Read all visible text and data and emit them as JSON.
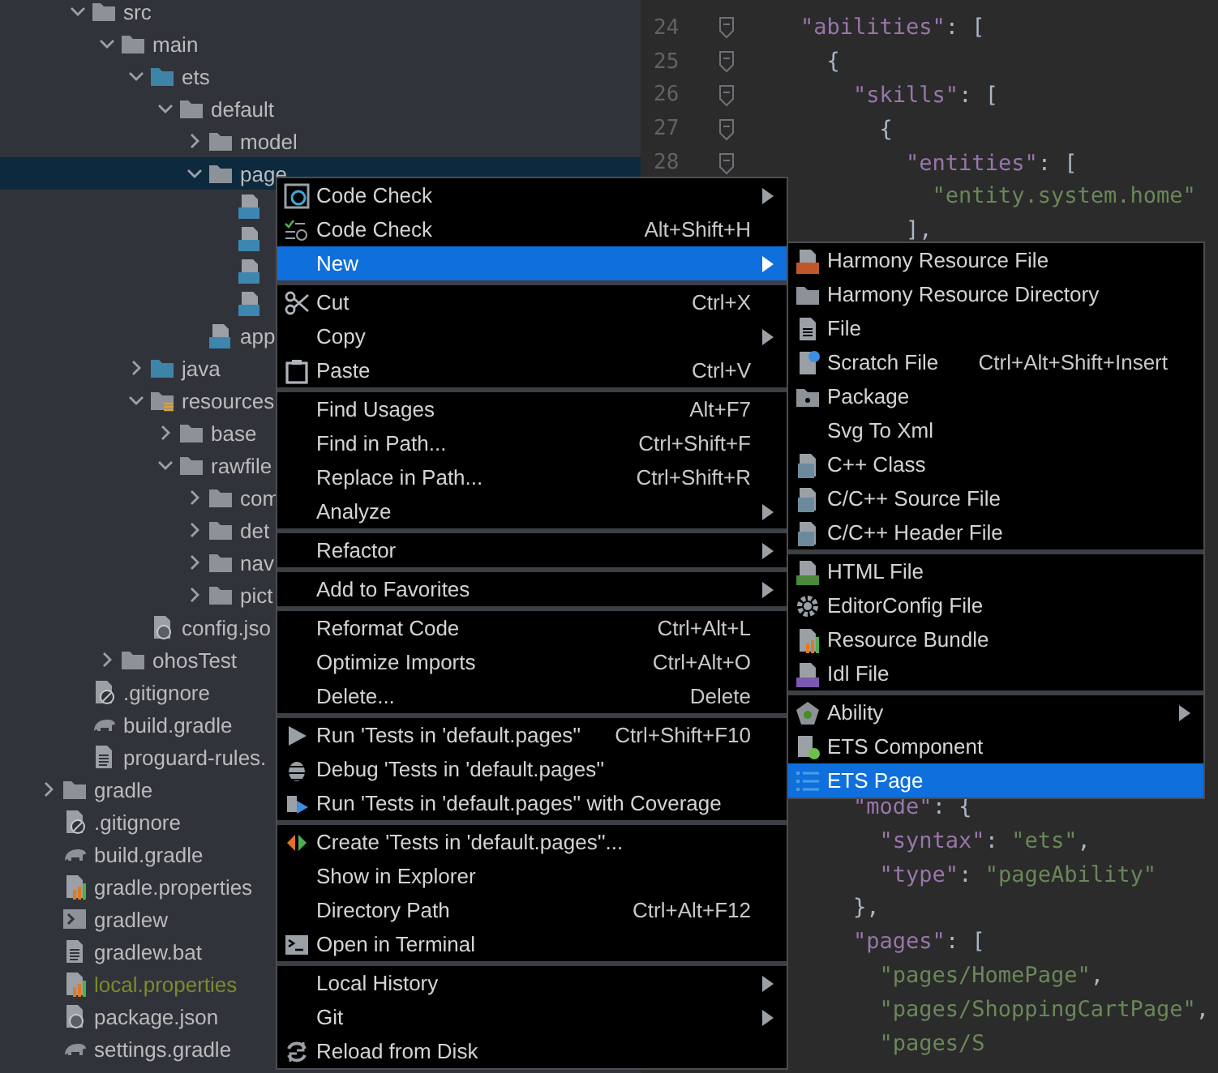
{
  "project_tree": {
    "partial_children": [
      {
        "label": "src",
        "kind": "folder",
        "expanded": true,
        "selected": false,
        "children": [
          {
            "label": "main",
            "kind": "folder",
            "expanded": true,
            "selected": false,
            "children": [
              {
                "label": "ets",
                "kind": "source-folder",
                "expanded": true,
                "selected": false,
                "children": [
                  {
                    "label": "default",
                    "kind": "folder",
                    "expanded": true,
                    "selected": false,
                    "children": [
                      {
                        "label": "model",
                        "kind": "folder",
                        "expanded": false,
                        "selected": false
                      },
                      {
                        "label": "page",
                        "kind": "folder",
                        "expanded": true,
                        "selected": true,
                        "children": [
                          {
                            "kind": "ts",
                            "selected": false
                          },
                          {
                            "kind": "ts",
                            "selected": false
                          },
                          {
                            "kind": "ts",
                            "selected": false
                          },
                          {
                            "kind": "ts",
                            "selected": false
                          }
                        ]
                      },
                      {
                        "label": "app",
                        "kind": "ts",
                        "selected": false
                      }
                    ]
                  }
                ]
              },
              {
                "label": "java",
                "kind": "source-folder",
                "expanded": false,
                "selected": false
              },
              {
                "label": "resources",
                "kind": "resources-folder",
                "expanded": true,
                "selected": false,
                "children": [
                  {
                    "label": "base",
                    "kind": "folder",
                    "expanded": false,
                    "selected": false
                  },
                  {
                    "label": "rawfile",
                    "kind": "folder",
                    "expanded": true,
                    "selected": false,
                    "children": [
                      {
                        "label": "com",
                        "kind": "folder",
                        "expanded": false,
                        "selected": false
                      },
                      {
                        "label": "det",
                        "kind": "folder",
                        "expanded": false,
                        "selected": false
                      },
                      {
                        "label": "nav",
                        "kind": "folder",
                        "expanded": false,
                        "selected": false
                      },
                      {
                        "label": "pict",
                        "kind": "folder",
                        "expanded": false,
                        "selected": false
                      }
                    ]
                  }
                ]
              },
              {
                "label": "config.jso",
                "kind": "json",
                "selected": false
              }
            ]
          },
          {
            "label": "ohosTest",
            "kind": "folder",
            "expanded": false,
            "selected": false
          }
        ]
      },
      {
        "label": ".gitignore",
        "kind": "ignore",
        "selected": false
      },
      {
        "label": "build.gradle",
        "kind": "gradle",
        "selected": false
      },
      {
        "label": "proguard-rules.",
        "kind": "text",
        "selected": false
      }
    ],
    "items": [
      {
        "label": "gradle",
        "kind": "folder",
        "expanded": false,
        "selected": false
      },
      {
        "label": ".gitignore",
        "kind": "ignore",
        "selected": false
      },
      {
        "label": "build.gradle",
        "kind": "gradle",
        "selected": false
      },
      {
        "label": "gradle.properties",
        "kind": "properties",
        "selected": false
      },
      {
        "label": "gradlew",
        "kind": "script",
        "selected": false
      },
      {
        "label": "gradlew.bat",
        "kind": "text",
        "selected": false
      },
      {
        "label": "local.properties",
        "kind": "properties",
        "selected": false,
        "color": "#7d8a2c"
      },
      {
        "label": "package.json",
        "kind": "json",
        "selected": false
      },
      {
        "label": "settings.gradle",
        "kind": "gradle",
        "selected": false
      }
    ]
  },
  "editor": {
    "top_lines": [
      {
        "number": "24",
        "fold": true,
        "text": "    \"abilities\": ["
      },
      {
        "number": "25",
        "fold": true,
        "text": "      {"
      },
      {
        "number": "26",
        "fold": true,
        "text": "        \"skills\": ["
      },
      {
        "number": "27",
        "fold": true,
        "text": "          {"
      },
      {
        "number": "28",
        "fold": true,
        "text": "            \"entities\": ["
      },
      {
        "text": "              \"entity.system.home\""
      },
      {
        "text": "            ],"
      }
    ],
    "bottom_lines": [
      {
        "text": "        \"mode\": {"
      },
      {
        "text": "          \"syntax\": \"ets\","
      },
      {
        "text": "          \"type\": \"pageAbility\""
      },
      {
        "text": "        },"
      },
      {
        "text": "        \"pages\": ["
      },
      {
        "text": "          \"pages/HomePage\","
      },
      {
        "text": "          \"pages/ShoppingCartPage\","
      },
      {
        "text": "          \"pages/S"
      }
    ]
  },
  "context_menu": {
    "groups": [
      {
        "items": [
          {
            "label": "Code Check",
            "submenu": true,
            "selected": false
          },
          {
            "label": "Code Check",
            "shortcut": "Alt+Shift+H",
            "submenu": false,
            "selected": false
          },
          {
            "label": "New",
            "submenu": true,
            "selected": true
          }
        ]
      },
      {
        "items": [
          {
            "label": "Cut",
            "shortcut": "Ctrl+X",
            "submenu": false,
            "selected": false
          },
          {
            "label": "Copy",
            "submenu": true,
            "selected": false
          },
          {
            "label": "Paste",
            "shortcut": "Ctrl+V",
            "submenu": false,
            "selected": false
          }
        ]
      },
      {
        "items": [
          {
            "label": "Find Usages",
            "shortcut": "Alt+F7",
            "submenu": false,
            "selected": false
          },
          {
            "label": "Find in Path...",
            "shortcut": "Ctrl+Shift+F",
            "submenu": false,
            "selected": false
          },
          {
            "label": "Replace in Path...",
            "shortcut": "Ctrl+Shift+R",
            "submenu": false,
            "selected": false
          },
          {
            "label": "Analyze",
            "submenu": true,
            "selected": false
          }
        ]
      },
      {
        "items": [
          {
            "label": "Refactor",
            "submenu": true,
            "selected": false
          }
        ]
      },
      {
        "items": [
          {
            "label": "Add to Favorites",
            "submenu": true,
            "selected": false
          }
        ]
      },
      {
        "items": [
          {
            "label": "Reformat Code",
            "shortcut": "Ctrl+Alt+L",
            "submenu": false,
            "selected": false
          },
          {
            "label": "Optimize Imports",
            "shortcut": "Ctrl+Alt+O",
            "submenu": false,
            "selected": false
          },
          {
            "label": "Delete...",
            "shortcut": "Delete",
            "submenu": false,
            "selected": false
          }
        ]
      },
      {
        "items": [
          {
            "label": "Run 'Tests in 'default.pages''",
            "shortcut": "Ctrl+Shift+F10",
            "submenu": false,
            "selected": false
          },
          {
            "label": "Debug 'Tests in 'default.pages''",
            "submenu": false,
            "selected": false
          },
          {
            "label": "Run 'Tests in 'default.pages'' with Coverage",
            "submenu": false,
            "selected": false
          }
        ]
      },
      {
        "items": [
          {
            "label": "Create 'Tests in 'default.pages''...",
            "submenu": false,
            "selected": false
          },
          {
            "label": "Show in Explorer",
            "submenu": false,
            "selected": false
          },
          {
            "label": "Directory Path",
            "shortcut": "Ctrl+Alt+F12",
            "submenu": false,
            "selected": false
          },
          {
            "label": "Open in Terminal",
            "submenu": false,
            "selected": false
          }
        ]
      },
      {
        "items": [
          {
            "label": "Local History",
            "submenu": true,
            "selected": false
          },
          {
            "label": "Git",
            "submenu": true,
            "selected": false
          },
          {
            "label": "Reload from Disk",
            "submenu": false,
            "selected": false
          }
        ]
      }
    ]
  },
  "new_submenu": {
    "groups": [
      {
        "items": [
          {
            "label": "Harmony Resource File",
            "submenu": false,
            "selected": false
          },
          {
            "label": "Harmony Resource Directory",
            "submenu": false,
            "selected": false
          },
          {
            "label": "File",
            "submenu": false,
            "selected": false
          },
          {
            "label": "Scratch File",
            "shortcut": "Ctrl+Alt+Shift+Insert",
            "submenu": false,
            "selected": false
          },
          {
            "label": "Package",
            "submenu": false,
            "selected": false
          },
          {
            "label": "Svg To Xml",
            "submenu": false,
            "selected": false
          },
          {
            "label": "C++ Class",
            "submenu": false,
            "selected": false
          },
          {
            "label": "C/C++ Source File",
            "submenu": false,
            "selected": false
          },
          {
            "label": "C/C++ Header File",
            "submenu": false,
            "selected": false
          }
        ]
      },
      {
        "items": [
          {
            "label": "HTML File",
            "submenu": false,
            "selected": false
          },
          {
            "label": "EditorConfig File",
            "submenu": false,
            "selected": false
          },
          {
            "label": "Resource Bundle",
            "submenu": false,
            "selected": false
          },
          {
            "label": "Idl File",
            "submenu": false,
            "selected": false
          }
        ]
      },
      {
        "items": [
          {
            "label": "Ability",
            "submenu": true,
            "selected": false
          },
          {
            "label": "ETS Component",
            "submenu": false,
            "selected": false
          },
          {
            "label": "ETS Page",
            "submenu": false,
            "selected": true
          }
        ]
      }
    ]
  }
}
